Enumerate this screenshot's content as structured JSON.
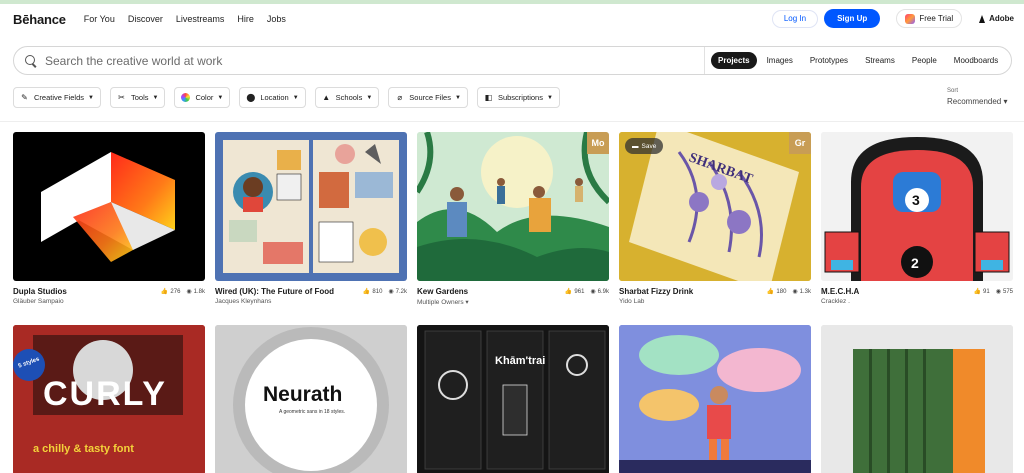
{
  "nav": {
    "logo": "Bēhance",
    "links": [
      "For You",
      "Discover",
      "Livestreams",
      "Hire",
      "Jobs"
    ],
    "login": "Log In",
    "signup": "Sign Up",
    "trial": "Free Trial",
    "adobe": "Adobe"
  },
  "search": {
    "placeholder": "Search the creative world at work",
    "scopes": [
      "Projects",
      "Images",
      "Prototypes",
      "Streams",
      "People",
      "Moodboards"
    ],
    "active_scope": "Projects"
  },
  "filters": [
    {
      "label": "Creative Fields",
      "icon": "palette-icon"
    },
    {
      "label": "Tools",
      "icon": "tools-icon"
    },
    {
      "label": "Color",
      "icon": "color-wheel-icon"
    },
    {
      "label": "Location",
      "icon": "location-pin-icon"
    },
    {
      "label": "Schools",
      "icon": "graduation-cap-icon"
    },
    {
      "label": "Source Files",
      "icon": "paperclip-icon"
    },
    {
      "label": "Subscriptions",
      "icon": "subscriptions-icon"
    }
  ],
  "sort": {
    "label": "Sort",
    "value": "Recommended"
  },
  "projects": [
    {
      "title": "Dupla Studios",
      "owner": "Gläuber Sampaio",
      "likes": "276",
      "views": "1.8k"
    },
    {
      "title": "Wired (UK): The Future of Food",
      "owner": "Jacques Kleynhans",
      "likes": "810",
      "views": "7.2k"
    },
    {
      "title": "Kew Gardens",
      "owner": "Multiple Owners",
      "likes": "961",
      "views": "6.9k",
      "badge": "Mo"
    },
    {
      "title": "Sharbat Fizzy Drink",
      "owner": "Yido Lab",
      "likes": "180",
      "views": "1.3k",
      "badge": "Gr",
      "save": "Save"
    },
    {
      "title": "M.E.C.H.A",
      "owner": "Cracklez .",
      "likes": "91",
      "views": "575"
    }
  ],
  "row2_text": {
    "curly_sticker": "5 styles",
    "curly_title": "CURLY",
    "curly_sub": "a chilly & tasty font",
    "neurath_title": "Neurath",
    "neurath_sub": "A geometric sans in 18 styles.",
    "kham_title": "Khām'trai"
  },
  "colors": {
    "accent": "#0057ff",
    "active_scope_bg": "#191919"
  }
}
